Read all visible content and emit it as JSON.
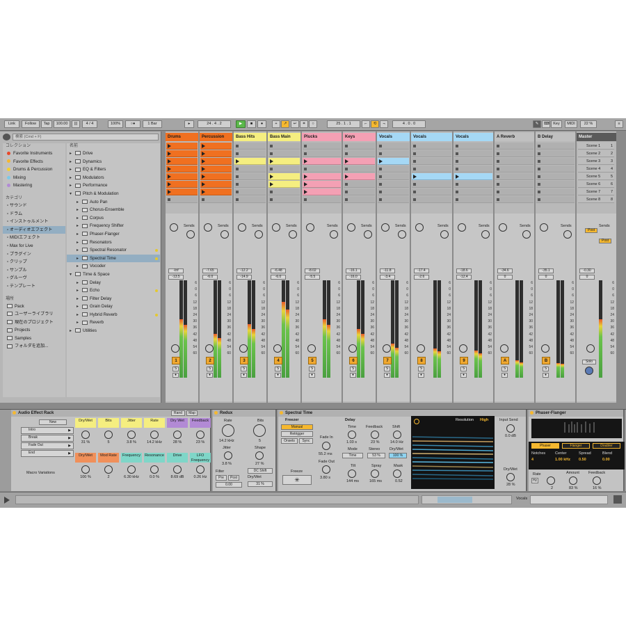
{
  "transport": {
    "link": "Link",
    "follow": "Follow",
    "tap": "Tap",
    "tempo": "100.00",
    "sig": "4 / 4",
    "zoom": "100%",
    "quant": "1 Bar",
    "pos": "24 .  4 .  2",
    "pos2": "25 .  1 .  1",
    "len": "4 .  0 .  0",
    "key": "Key",
    "midi": "MIDI",
    "cpu": "22 %"
  },
  "browser": {
    "search_placeholder": "検索 (Cmd + F)",
    "collections_title": "コレクション",
    "collections": [
      {
        "label": "Favorite Instruments",
        "color": "#e8482a"
      },
      {
        "label": "Favorite Effects",
        "color": "#f5b830"
      },
      {
        "label": "Drums & Percussion",
        "color": "#f5d030"
      },
      {
        "label": "Mixing",
        "color": "#7bc9e8"
      },
      {
        "label": "Mastering",
        "color": "#b28ad5"
      }
    ],
    "category_title": "カテゴリ",
    "categories": [
      "サウンド",
      "ドラム",
      "インストゥルメント",
      "オーディオエフェクト",
      "MIDIエフェクト",
      "Max for Live",
      "プラグイン",
      "クリップ",
      "サンプル",
      "グルーヴ",
      "テンプレート"
    ],
    "places_title": "場所",
    "places": [
      "Pack",
      "ユーザーライブラリ",
      "現在のプロジェクト",
      "Projects",
      "Samples",
      "フォルダを追加..."
    ],
    "name_header": "名前",
    "items": [
      {
        "label": "Drive",
        "lvl": 0
      },
      {
        "label": "Dynamics",
        "lvl": 0
      },
      {
        "label": "EQ & Filters",
        "lvl": 0
      },
      {
        "label": "Modulators",
        "lvl": 0
      },
      {
        "label": "Performance",
        "lvl": 0
      },
      {
        "label": "Pitch & Modulation",
        "lvl": 0,
        "open": true
      },
      {
        "label": "Auto Pan",
        "lvl": 1
      },
      {
        "label": "Chorus-Ensemble",
        "lvl": 1
      },
      {
        "label": "Corpus",
        "lvl": 1
      },
      {
        "label": "Frequency Shifter",
        "lvl": 1
      },
      {
        "label": "Phaser-Flanger",
        "lvl": 1
      },
      {
        "label": "Resonators",
        "lvl": 1
      },
      {
        "label": "Spectral Resonator",
        "lvl": 1,
        "dot": true
      },
      {
        "label": "Spectral Time",
        "lvl": 1,
        "sel": true,
        "dot": true
      },
      {
        "label": "Vocoder",
        "lvl": 1
      },
      {
        "label": "Time & Space",
        "lvl": 0,
        "open": true
      },
      {
        "label": "Delay",
        "lvl": 1
      },
      {
        "label": "Echo",
        "lvl": 1,
        "dot": true
      },
      {
        "label": "Filter Delay",
        "lvl": 1
      },
      {
        "label": "Grain Delay",
        "lvl": 1
      },
      {
        "label": "Hybrid Reverb",
        "lvl": 1,
        "dot": true
      },
      {
        "label": "Reverb",
        "lvl": 1
      },
      {
        "label": "Utilities",
        "lvl": 0
      }
    ]
  },
  "tracks": [
    {
      "name": "Drums",
      "color": "#f07020",
      "clipcolor": "#f07020",
      "w": 48,
      "clips": [
        1,
        1,
        1,
        1,
        1,
        1,
        1
      ],
      "vol": "-Inf",
      "pan": "-13.5",
      "num": "1",
      "meter": 0.6
    },
    {
      "name": "Percussion",
      "color": "#f07020",
      "clipcolor": "#f07020",
      "w": 48,
      "clips": [
        1,
        1,
        1,
        1,
        1,
        1,
        1
      ],
      "vol": "-7.65",
      "pan": "-6.0",
      "num": "2",
      "meter": 0.45
    },
    {
      "name": "Bass Hits",
      "color": "#f5ee80",
      "clipcolor": "#f5ee80",
      "w": 48,
      "clips": [
        0,
        0,
        1,
        0,
        0,
        0,
        0
      ],
      "vol": "-12.2",
      "pan": "-14.9",
      "num": "3",
      "meter": 0.55
    },
    {
      "name": "Bass Main",
      "color": "#f5ee80",
      "clipcolor": "#f5ee80",
      "w": 48,
      "clips": [
        0,
        0,
        1,
        0,
        1,
        1,
        0
      ],
      "vol": "-6.48",
      "pan": "-6.0",
      "num": "4",
      "meter": 0.78
    },
    {
      "name": "Plucks",
      "color": "#f4a0b4",
      "clipcolor": "#f4a0b4",
      "w": 58,
      "clips": [
        0,
        0,
        1,
        0,
        1,
        1,
        1
      ],
      "vol": "-8.02",
      "pan": "-5.5",
      "num": "5",
      "meter": 0.6
    },
    {
      "name": "Keys",
      "color": "#f4a0b4",
      "clipcolor": "#f4a0b4",
      "w": 48,
      "clips": [
        0,
        0,
        1,
        0,
        1,
        0,
        0
      ],
      "vol": "-16.1",
      "pan": "-16.0",
      "num": "6",
      "meter": 0.5
    },
    {
      "name": "Vocals",
      "color": "#a5d8f5",
      "clipcolor": "#a5d8f5",
      "w": 48,
      "clips": [
        0,
        0,
        1,
        0,
        0,
        0,
        0
      ],
      "vol": "-11.8",
      "pan": "-3.4",
      "num": "7",
      "meter": 0.35
    },
    {
      "name": "Vocals",
      "color": "#a5d8f5",
      "clipcolor": "#a5d8f5",
      "w": 60,
      "clips": [
        0,
        0,
        0,
        0,
        1,
        0,
        0
      ],
      "vol": "-17.4",
      "pan": "-2.6",
      "num": "8",
      "meter": 0.3
    },
    {
      "name": "Vocals",
      "color": "#a5d8f5",
      "clipcolor": "#a5d8f5",
      "w": 58,
      "clips": [
        0,
        0,
        0,
        0,
        1,
        0,
        0
      ],
      "vol": "-18.6",
      "pan": "-12.4",
      "num": "9",
      "meter": 0.28
    },
    {
      "name": "A Reverb",
      "color": "#c0c0c0",
      "clipcolor": "#c0c0c0",
      "w": 58,
      "clips": [
        0,
        0,
        0,
        0,
        0,
        0,
        0
      ],
      "vol": "-34.6",
      "pan": "0",
      "num": "A",
      "meter": 0.18
    },
    {
      "name": "B Delay",
      "color": "#c0c0c0",
      "clipcolor": "#c0c0c0",
      "w": 58,
      "clips": [
        0,
        0,
        0,
        0,
        0,
        0,
        0
      ],
      "vol": "-35.1",
      "pan": "0",
      "num": "B",
      "meter": 0.15
    }
  ],
  "master": {
    "name": "Master",
    "vol": "-0.30",
    "pan": "0",
    "sends": "Sends",
    "post": "Post",
    "solo": "Solo",
    "scenes": [
      "Scene 1",
      "Scene 2",
      "Scene 3",
      "Scene 4",
      "Scene 5",
      "Scene 6",
      "Scene 7",
      "Scene 8"
    ],
    "meter": 0.6
  },
  "mixer": {
    "sends": "Sends",
    "scale": [
      "6",
      "0",
      "6",
      "12",
      "18",
      "24",
      "30",
      "36",
      "42",
      "48",
      "54",
      "60"
    ]
  },
  "rack": {
    "title": "Audio Effect Rack",
    "new": "New",
    "rand": "Rand",
    "map": "Map",
    "chains": [
      "Intro",
      "Break",
      "Fade Out",
      "End"
    ],
    "macro_variations": "Macro Variations",
    "macros_top": [
      {
        "label": "Dry/Wet",
        "val": "31 %",
        "color": "#f5ee80"
      },
      {
        "label": "Bits",
        "val": "5",
        "color": "#f5ee80"
      },
      {
        "label": "Jitter",
        "val": "3.8 %",
        "color": "#f5ee80"
      },
      {
        "label": "Rate",
        "val": "14.2 kHz",
        "color": "#f5ee80"
      },
      {
        "label": "Dry Wet",
        "val": "28 %",
        "color": "#b28ad5"
      },
      {
        "label": "Feedback",
        "val": "23 %",
        "color": "#b28ad5"
      }
    ],
    "macros_bottom": [
      {
        "label": "Dry/Wet",
        "val": "100 %",
        "color": "#f0905a"
      },
      {
        "label": "Mod Rate",
        "val": "2",
        "color": "#f0905a"
      },
      {
        "label": "Frequency",
        "val": "6.30 kHz",
        "color": "#7fd6c8"
      },
      {
        "label": "Resonance",
        "val": "0.0 %",
        "color": "#7fd6c8"
      },
      {
        "label": "Drive",
        "val": "8.69 dB",
        "color": "#7fd6c8"
      },
      {
        "label": "LFO Frequency",
        "val": "0.26 Hz",
        "color": "#7fd6c8"
      }
    ]
  },
  "redux": {
    "title": "Redux",
    "rate": "Rate",
    "rate_val": "14.2 kHz",
    "bits": "Bits",
    "bits_val": "5",
    "jitter": "Jitter",
    "jitter_val": "3.8 %",
    "shape": "Shape",
    "shape_val": "27 %",
    "dc": "DC Shift",
    "filter": "Filter",
    "pre": "Pre",
    "post": "Post",
    "filter_val": "0.00",
    "drywet": "Dry/Wet",
    "drywet_val": "31 %"
  },
  "spectral": {
    "title": "Spectral Time",
    "freezer": "Freezer",
    "manual": "Manual",
    "retrigger": "Retrigger",
    "onsets": "Onsets",
    "sync": "Sync",
    "fadein": "Fade In",
    "fadein_val": "55.2 ms",
    "fadeout": "Fade Out",
    "fadeout_val": "3.80 s",
    "freeze": "Freeze",
    "delay": "Delay",
    "time": "Time",
    "time_val": "1.03 s",
    "feedback": "Feedback",
    "feedback_val": "23 %",
    "shift": "Shift",
    "shift_val": "14.0 Hz",
    "mode": "Mode",
    "mode_val": "Time",
    "stereo": "Stereo",
    "stereo_val": "53 %",
    "drywet": "Dry/Wet",
    "drywet_val": "100 %",
    "tilt": "Tilt",
    "tilt_val": "144 ms",
    "spray": "Spray",
    "spray_val": "165 ms",
    "mask": "Mask",
    "mask_val": "0.52",
    "resolution": "Resolution",
    "res_val": "High",
    "input_send": "Input Send",
    "input_send_val": "0.0 dB",
    "dw2": "Dry/Wet",
    "dw2_val": "28 %"
  },
  "phaser": {
    "title": "Phaser-Flanger",
    "modes": [
      "Phaser",
      "Flanger",
      "Doubler"
    ],
    "notches": "Notches",
    "notches_val": "4",
    "center": "Center",
    "center_val": "1.00 kHz",
    "spread": "Spread",
    "spread_val": "0.50",
    "blend": "Blend",
    "blend_val": "0.00",
    "rate": "Rate",
    "rate_val": "2",
    "amount": "Amount",
    "amount_val": "83 %",
    "feedback": "Feedback",
    "feedback_val": "16 %",
    "hz": "Hz"
  },
  "status": {
    "track": "Vocals"
  }
}
